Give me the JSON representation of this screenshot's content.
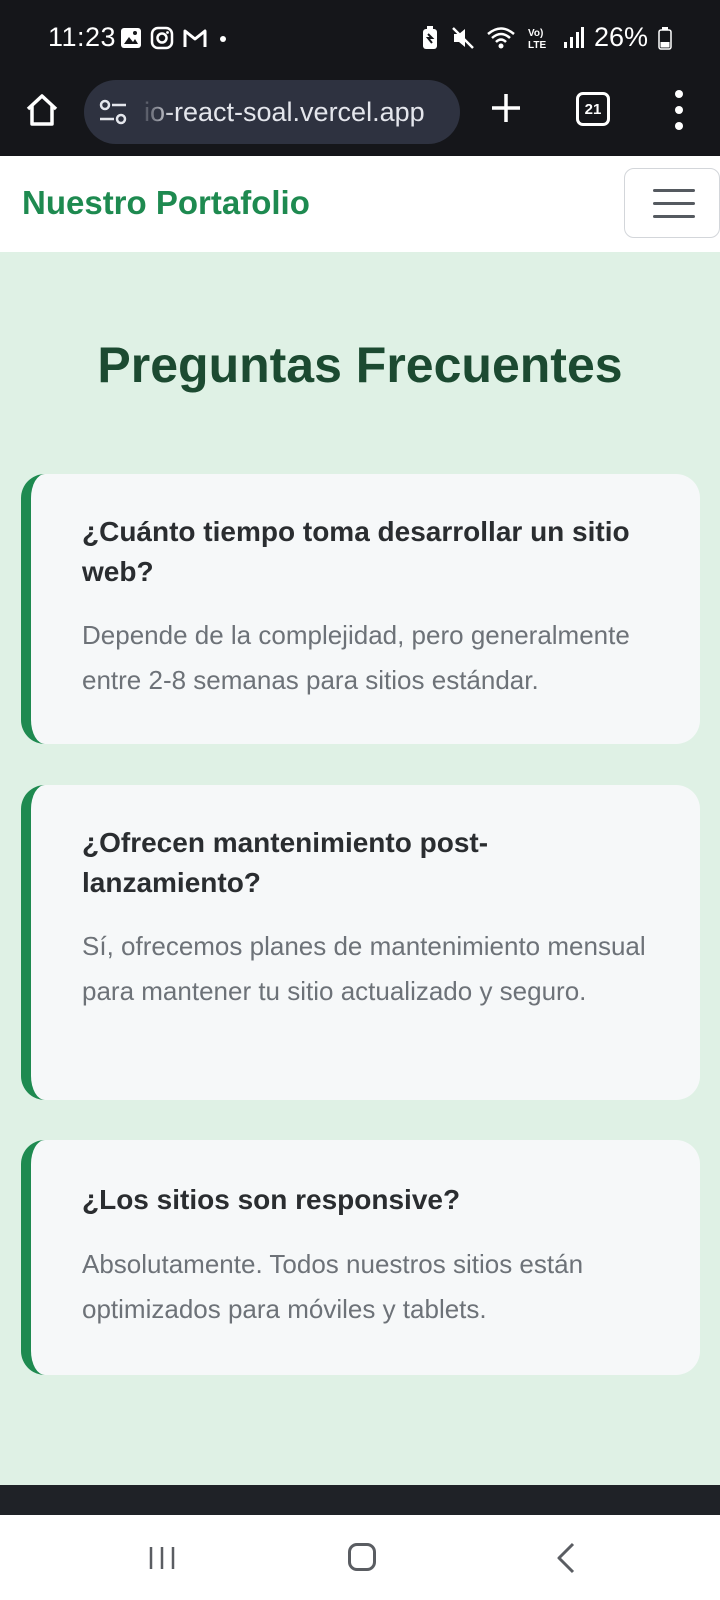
{
  "status_bar": {
    "time": "11:23",
    "battery": "26%"
  },
  "browser": {
    "url": "io-react-soal.vercel.app",
    "tab_count": "21"
  },
  "navbar": {
    "brand": "Nuestro Portafolio"
  },
  "faq": {
    "title": "Preguntas Frecuentes",
    "items": [
      {
        "question": "¿Cuánto tiempo toma desarrollar un sitio web?",
        "answer": "Depende de la complejidad, pero generalmente entre 2-8 semanas para sitios estándar."
      },
      {
        "question": "¿Ofrecen mantenimiento post-lanzamiento?",
        "answer": "Sí, ofrecemos planes de mantenimiento mensual para mantener tu sitio actualizado y seguro."
      },
      {
        "question": "¿Los sitios son responsive?",
        "answer": "Absolutamente. Todos nuestros sitios están optimizados para móviles y tablets."
      }
    ]
  },
  "colors": {
    "brand_green": "#1e8a50",
    "section_bg": "#dff1e5",
    "title_dark_green": "#1c4a31",
    "card_bg": "#f6f8f9",
    "status_bar_bg": "#15161a"
  },
  "icons": {
    "status_left": [
      "gallery-icon",
      "instagram-icon",
      "gmail-icon",
      "dot-icon"
    ],
    "status_right": [
      "battery-saver-icon",
      "mute-icon",
      "wifi-icon",
      "volte-icon",
      "signal-icon",
      "battery-icon"
    ],
    "browser": [
      "home-icon",
      "site-settings-icon",
      "new-tab-plus-icon",
      "tabs-icon",
      "overflow-menu-icon"
    ],
    "android_nav": [
      "recent-apps-icon",
      "home-nav-icon",
      "back-icon"
    ]
  }
}
